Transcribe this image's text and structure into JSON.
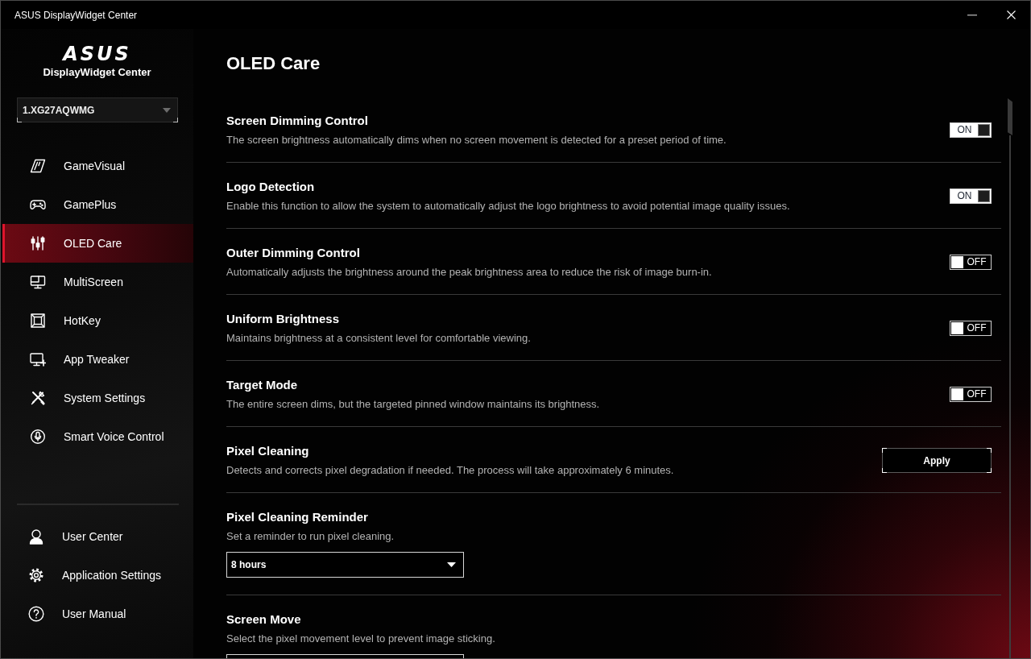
{
  "window": {
    "title": "ASUS DisplayWidget Center"
  },
  "sidebar": {
    "logo": "ASUS",
    "app_name": "DisplayWidget Center",
    "monitor_select": {
      "value": "1.XG27AQWMG"
    },
    "items": [
      {
        "label": "GameVisual",
        "selected": false
      },
      {
        "label": "GamePlus",
        "selected": false
      },
      {
        "label": "OLED Care",
        "selected": true
      },
      {
        "label": "MultiScreen",
        "selected": false
      },
      {
        "label": "HotKey",
        "selected": false
      },
      {
        "label": "App Tweaker",
        "selected": false
      },
      {
        "label": "System Settings",
        "selected": false
      },
      {
        "label": "Smart Voice Control",
        "selected": false
      }
    ],
    "footer_items": [
      {
        "label": "User Center",
        "selected": false
      },
      {
        "label": "Application Settings",
        "selected": false
      },
      {
        "label": "User Manual",
        "selected": false
      }
    ]
  },
  "page": {
    "title": "OLED Care",
    "settings": [
      {
        "kind": "toggle",
        "title": "Screen Dimming Control",
        "description": "The screen brightness automatically dims when no screen movement is detected for a preset period of time.",
        "on": true,
        "label": "ON"
      },
      {
        "kind": "toggle",
        "title": "Logo Detection",
        "description": "Enable this function to allow the system to automatically adjust the logo brightness to avoid potential image quality issues.",
        "on": true,
        "label": "ON"
      },
      {
        "kind": "toggle",
        "title": "Outer Dimming Control",
        "description": "Automatically adjusts the brightness around the peak brightness area to reduce the risk of image burn-in.",
        "on": false,
        "label": "OFF"
      },
      {
        "kind": "toggle",
        "title": "Uniform Brightness",
        "description": "Maintains brightness at a consistent level for comfortable viewing.",
        "on": false,
        "label": "OFF"
      },
      {
        "kind": "toggle",
        "title": "Target Mode",
        "description": "The entire screen dims, but the targeted pinned window maintains its brightness.",
        "on": false,
        "label": "OFF"
      },
      {
        "kind": "button",
        "title": "Pixel Cleaning",
        "description": "Detects and corrects pixel degradation if needed. The process will take approximately 6 minutes.",
        "button": "Apply"
      },
      {
        "kind": "dropdown",
        "title": "Pixel Cleaning Reminder",
        "description": "Set a reminder to run pixel cleaning.",
        "value": "8 hours"
      },
      {
        "kind": "dropdown",
        "title": "Screen Move",
        "description": "Select the pixel movement level to prevent image sticking."
      }
    ]
  }
}
